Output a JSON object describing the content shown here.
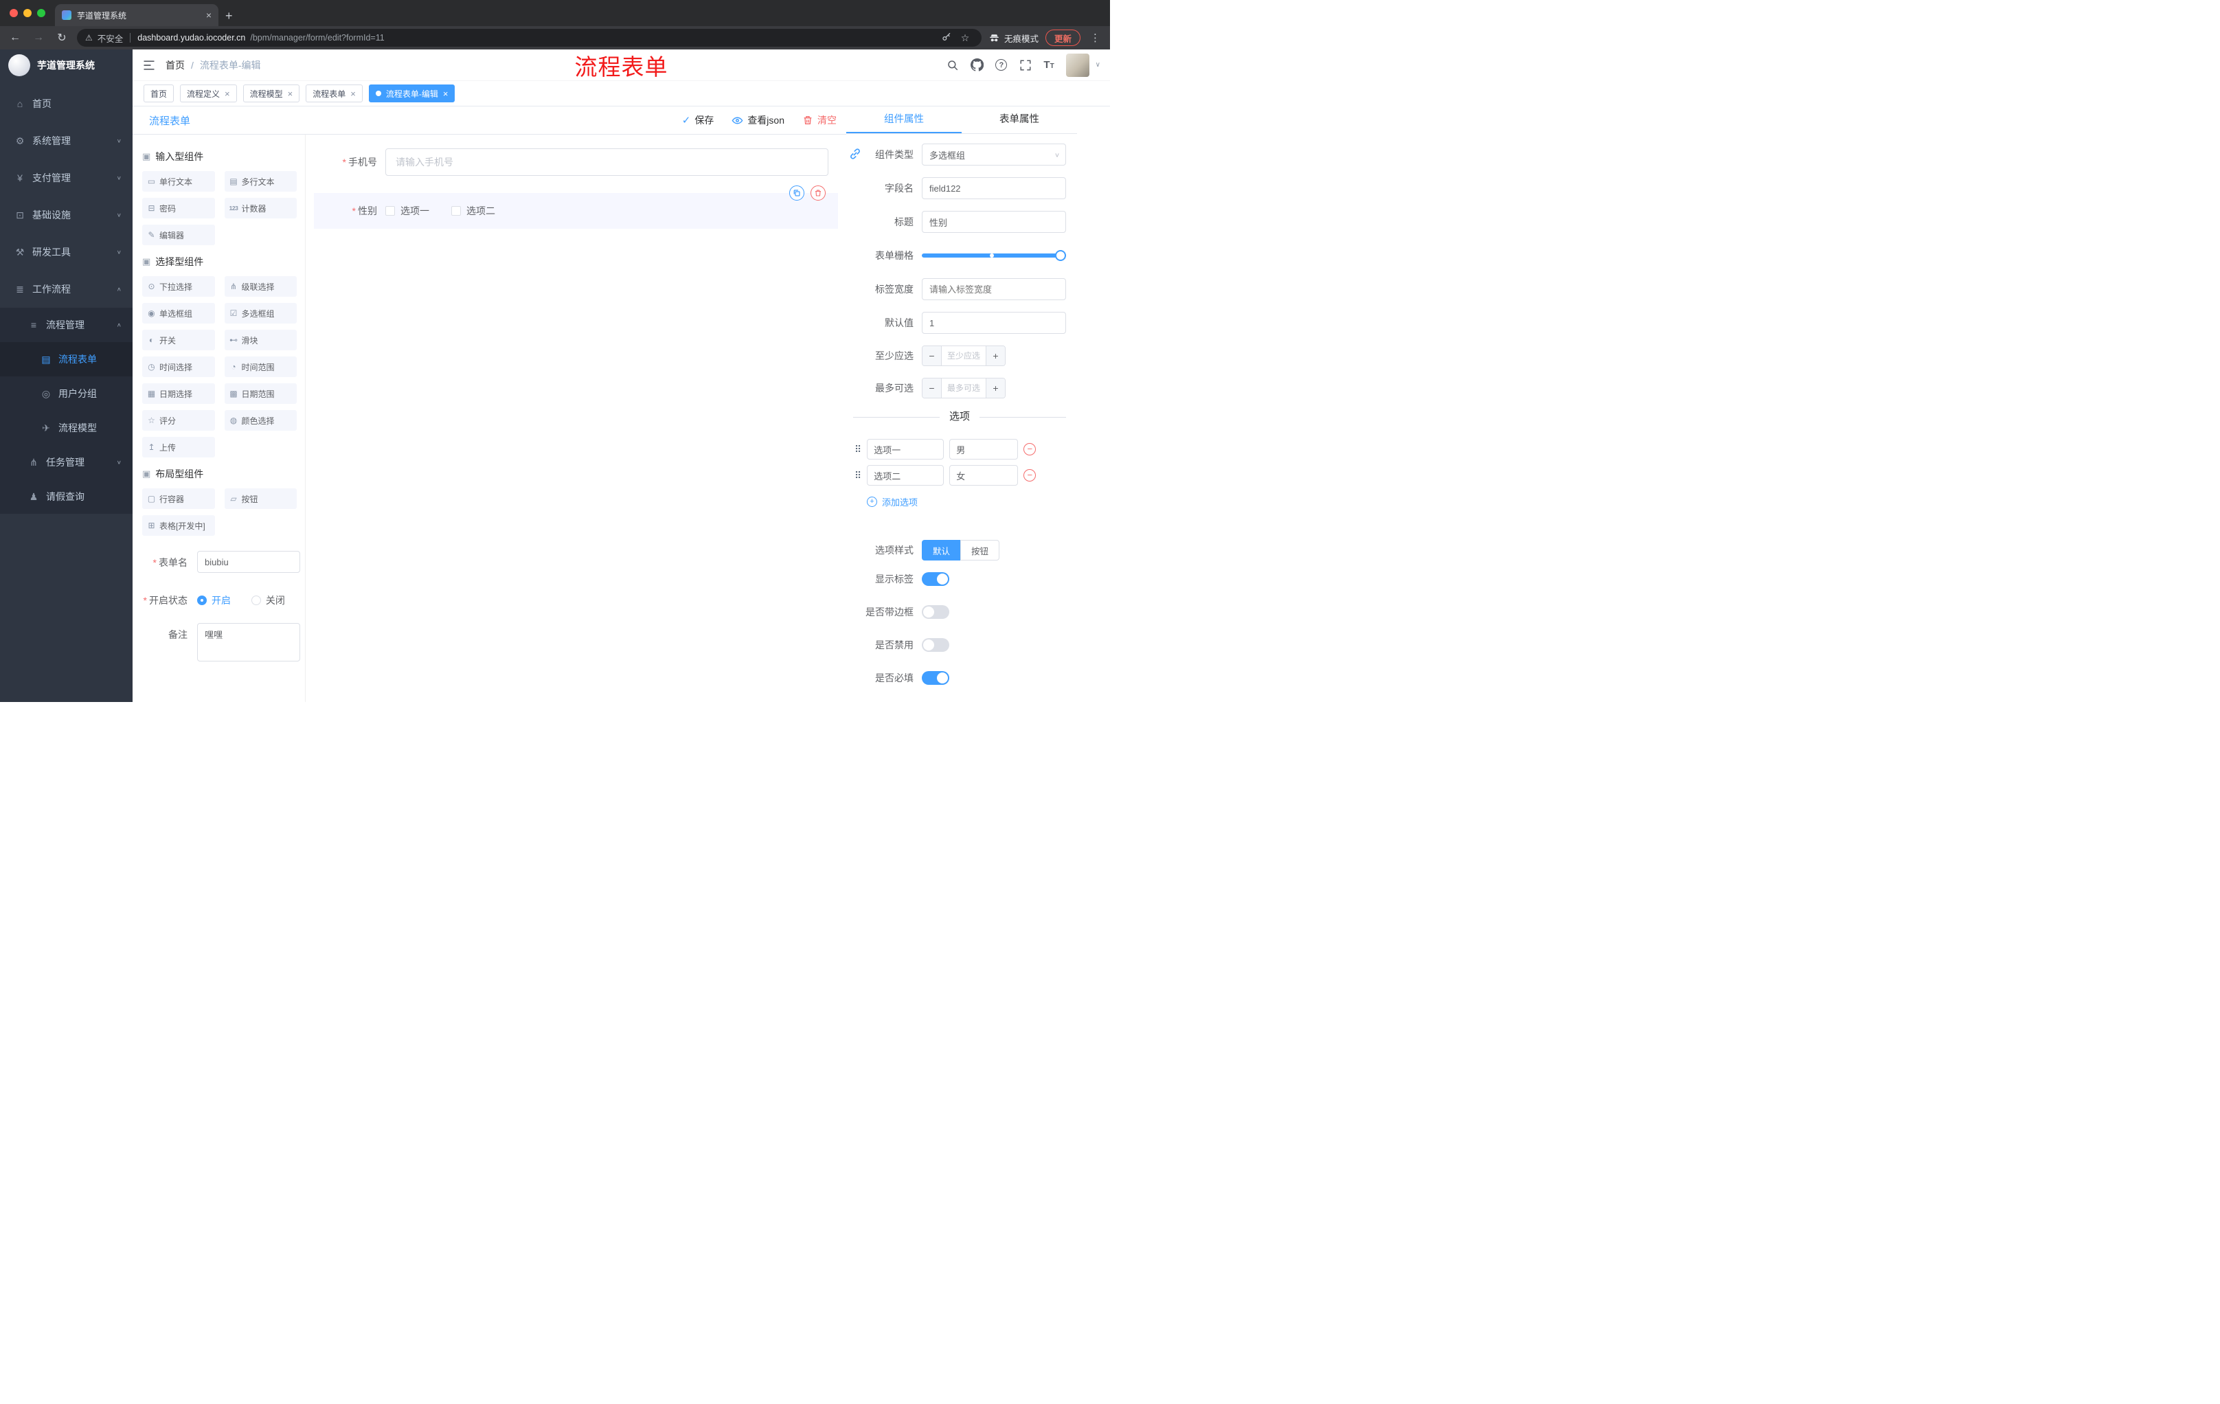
{
  "colors": {
    "accent": "#409eff",
    "danger": "#f56c6c",
    "annotation_red": "#f21b1b",
    "sidebar_bg": "#2f3642",
    "submenu_bg": "#262c38",
    "active_tab_bg": "#409eff",
    "chrome_frame": "#2b2c2e",
    "omnibox_bg": "#212225"
  },
  "icons": {
    "back": "←",
    "forward": "→",
    "reload": "↻",
    "warning": "⚠",
    "star": "☆",
    "kebab": "⋮",
    "caret_down": "∨",
    "caret_up": "∧",
    "minus": "−",
    "plus": "+",
    "check": "✓",
    "drag": "⠿",
    "close": "×"
  },
  "browser": {
    "tab_title": "芋道管理系统",
    "tab_close": "×",
    "new_tab": "+",
    "security_label": "不安全",
    "url_domain": "dashboard.yudao.iocoder.cn",
    "url_path": "/bpm/manager/form/edit?formId=11",
    "incognito_label": "无痕模式",
    "update_label": "更新"
  },
  "sidebar": {
    "logo_title": "芋道管理系统",
    "items": [
      {
        "icon": "⌂",
        "label": "首页"
      },
      {
        "icon": "⚙",
        "label": "系统管理",
        "chevron": "∨"
      },
      {
        "icon": "¥",
        "label": "支付管理",
        "chevron": "∨"
      },
      {
        "icon": "⊡",
        "label": "基础设施",
        "chevron": "∨"
      },
      {
        "icon": "⚒",
        "label": "研发工具",
        "chevron": "∨"
      },
      {
        "icon": "≣",
        "label": "工作流程",
        "chevron": "∧"
      },
      {
        "icon": "≡",
        "label": "流程管理",
        "chevron": "∧"
      },
      {
        "icon": "▤",
        "label": "流程表单"
      },
      {
        "icon": "◎",
        "label": "用户分组"
      },
      {
        "icon": "✈",
        "label": "流程模型"
      },
      {
        "icon": "⋔",
        "label": "任务管理",
        "chevron": "∨"
      },
      {
        "icon": "♟",
        "label": "请假查询"
      }
    ]
  },
  "header": {
    "breadcrumb_home": "首页",
    "breadcrumb_sep": "/",
    "breadcrumb_current": "流程表单-编辑",
    "annotation": "流程表单"
  },
  "tabs_bar": {
    "close_glyph": "×",
    "items": [
      {
        "label": "首页"
      },
      {
        "label": "流程定义"
      },
      {
        "label": "流程模型"
      },
      {
        "label": "流程表单"
      },
      {
        "label": "流程表单-编辑"
      }
    ]
  },
  "designer": {
    "panel_title": "流程表单",
    "actions": {
      "save": "保存",
      "view_json": "查看json",
      "clear": "清空"
    },
    "palette_groups": [
      {
        "title": "输入型组件",
        "items": [
          {
            "icon": "▭",
            "label": "单行文本"
          },
          {
            "icon": "▤",
            "label": "多行文本"
          },
          {
            "icon": "⊟",
            "label": "密码"
          },
          {
            "icon": "123",
            "label": "计数器"
          },
          {
            "icon": "✎",
            "label": "编辑器"
          }
        ]
      },
      {
        "title": "选择型组件",
        "items": [
          {
            "icon": "⊙",
            "label": "下拉选择"
          },
          {
            "icon": "⋔",
            "label": "级联选择"
          },
          {
            "icon": "◉",
            "label": "单选框组"
          },
          {
            "icon": "☑",
            "label": "多选框组"
          },
          {
            "icon": "◐",
            "label": "开关"
          },
          {
            "icon": "⊷",
            "label": "滑块"
          },
          {
            "icon": "◷",
            "label": "时间选择"
          },
          {
            "icon": "◔",
            "label": "时间范围"
          },
          {
            "icon": "▦",
            "label": "日期选择"
          },
          {
            "icon": "▩",
            "label": "日期范围"
          },
          {
            "icon": "☆",
            "label": "评分"
          },
          {
            "icon": "◍",
            "label": "颜色选择"
          },
          {
            "icon": "↥",
            "label": "上传"
          }
        ]
      },
      {
        "title": "布局型组件",
        "items": [
          {
            "icon": "▢",
            "label": "行容器"
          },
          {
            "icon": "▱",
            "label": "按钮"
          },
          {
            "icon": "⊞",
            "label": "表格[开发中]"
          }
        ]
      }
    ],
    "meta": {
      "name_label": "表单名",
      "name_value": "biubiu",
      "status_label": "开启状态",
      "status_on": "开启",
      "status_off": "关闭",
      "remark_label": "备注",
      "remark_value": "嘿嘿"
    },
    "canvas": {
      "phone_label": "手机号",
      "phone_placeholder": "请输入手机号",
      "gender_label": "性别",
      "gender_options": [
        "选项一",
        "选项二"
      ]
    }
  },
  "properties": {
    "tab_component": "组件属性",
    "tab_form": "表单属性",
    "rows": {
      "component_type": {
        "label": "组件类型",
        "value": "多选框组"
      },
      "field_name": {
        "label": "字段名",
        "value": "field122"
      },
      "title": {
        "label": "标题",
        "value": "性别"
      },
      "grid": {
        "label": "表单栅格"
      },
      "label_width": {
        "label": "标签宽度",
        "placeholder": "请输入标签宽度"
      },
      "default_value": {
        "label": "默认值",
        "value": "1"
      },
      "min_select": {
        "label": "至少应选",
        "placeholder": "至少应选"
      },
      "max_select": {
        "label": "最多可选",
        "placeholder": "最多可选"
      }
    },
    "options": {
      "divider_title": "选项",
      "rows": [
        {
          "label": "选项一",
          "value": "男"
        },
        {
          "label": "选项二",
          "value": "女"
        }
      ],
      "add_label": "添加选项"
    },
    "style_row": {
      "label": "选项样式",
      "options": [
        "默认",
        "按钮"
      ],
      "selected": "默认"
    },
    "switches": [
      {
        "label": "显示标签",
        "on": true
      },
      {
        "label": "是否带边框",
        "on": false
      },
      {
        "label": "是否禁用",
        "on": false
      },
      {
        "label": "是否必填",
        "on": true
      }
    ]
  }
}
